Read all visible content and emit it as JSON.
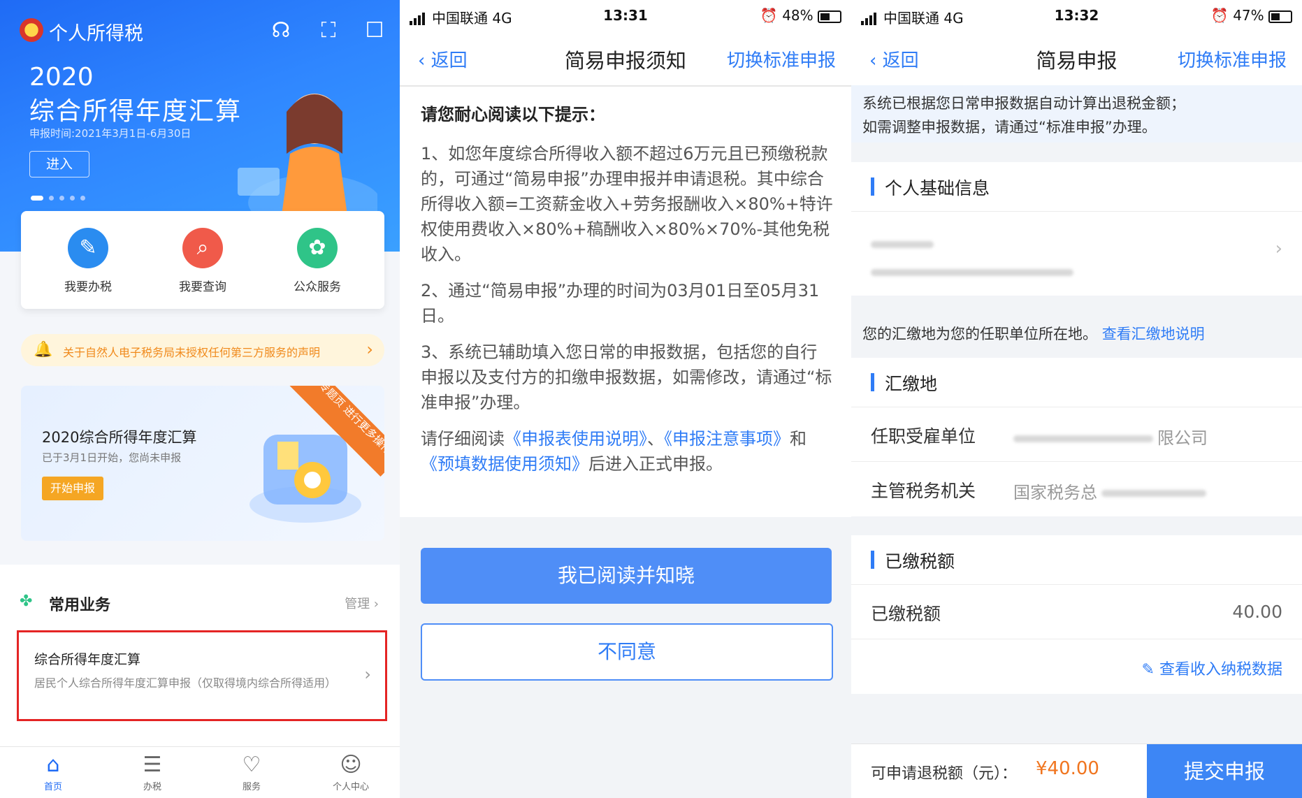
{
  "panel1": {
    "app_title": "个人所得税",
    "banner": {
      "year": "2020",
      "title": "综合所得年度汇算",
      "date": "申报时间:2021年3月1日-6月30日",
      "enter": "进入"
    },
    "quick": [
      {
        "label": "我要办税",
        "icon": "edit-icon",
        "color": "#2a8cf0"
      },
      {
        "label": "我要查询",
        "icon": "search-icon",
        "color": "#f05a4a"
      },
      {
        "label": "公众服务",
        "icon": "flower-icon",
        "color": "#2fc488"
      }
    ],
    "notice": "关于自然人电子税务局未授权任何第三方服务的声明",
    "promo": {
      "title": "2020综合所得年度汇算",
      "sub": "已于3月1日开始，您尚未申报",
      "button": "开始申报",
      "ribbon": "进入专题页 进行更多操作"
    },
    "business": {
      "header": "常用业务",
      "manage": "管理",
      "card_title": "综合所得年度汇算",
      "card_desc": "居民个人综合所得年度汇算申报（仅取得境内综合所得适用）"
    },
    "tabs": [
      {
        "label": "首页",
        "icon": "home-icon"
      },
      {
        "label": "办税",
        "icon": "document-icon"
      },
      {
        "label": "服务",
        "icon": "heart-hand-icon"
      },
      {
        "label": "个人中心",
        "icon": "person-icon"
      }
    ]
  },
  "panel2": {
    "status": {
      "carrier": "中国联通 4G",
      "time": "13:31",
      "battery": "48%"
    },
    "nav": {
      "back": "返回",
      "title": "简易申报须知",
      "switch": "切换标准申报"
    },
    "heading": "请您耐心阅读以下提示：",
    "items": [
      "1、如您年度综合所得收入额不超过6万元且已预缴税款的，可通过“简易申报”办理申报并申请退税。其中综合所得收入额=工资薪金收入+劳务报酬收入×80%+特许权使用费收入×80%+稿酬收入×80%×70%-其他免税收入。",
      "2、通过“简易申报”办理的时间为03月01日至05月31日。",
      "3、系统已辅助填入您日常的申报数据，包括您的自行申报以及支付方的扣缴申报数据，如需修改，请通过“标准申报”办理。"
    ],
    "read_prefix": "请仔细阅读",
    "link1": "《申报表使用说明》",
    "sep1": "、",
    "link2": "《申报注意事项》",
    "and": "和",
    "link3": "《预填数据使用须知》",
    "read_suffix": "后进入正式申报。",
    "agree": "我已阅读并知晓",
    "disagree": "不同意"
  },
  "panel3": {
    "status": {
      "carrier": "中国联通 4G",
      "time": "13:32",
      "battery": "47%"
    },
    "nav": {
      "back": "返回",
      "title": "简易申报",
      "switch": "切换标准申报"
    },
    "banner_line1": "系统已根据您日常申报数据自动计算出退税金额；",
    "banner_line2": "如需调整申报数据，请通过“标准申报”办理。",
    "sec_basic": "个人基础信息",
    "hint": "您的汇缴地为您的任职单位所在地。",
    "hint_link": "查看汇缴地说明",
    "sec_place": "汇缴地",
    "employer_label": "任职受雇单位",
    "employer_value": "限公司",
    "office_label": "主管税务机关",
    "office_value": "国家税务总",
    "sec_paid": "已缴税额",
    "paid_label": "已缴税额",
    "paid_value": "40.00",
    "view_data": "查看收入纳税数据",
    "refund_label": "可申请退税额（元）：",
    "refund_value": "¥40.00",
    "submit": "提交申报"
  }
}
